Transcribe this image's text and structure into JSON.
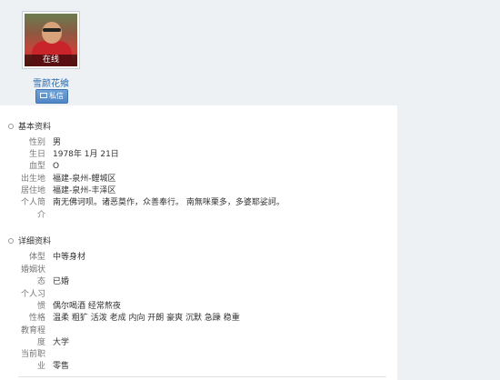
{
  "profile": {
    "status": "在线",
    "username": "雪颜花飨",
    "message_button": "私信"
  },
  "basic": {
    "title": "基本资料",
    "rows": [
      {
        "label": "性别",
        "value": "男"
      },
      {
        "label": "生日",
        "value": "1978年 1月 21日"
      },
      {
        "label": "血型",
        "value": "O"
      },
      {
        "label": "出生地",
        "value": "福建-泉州-鲤城区"
      },
      {
        "label": "居住地",
        "value": "福建-泉州-丰泽区"
      },
      {
        "label_line1": "个人简",
        "label_line2": "介",
        "value": "南无佛诃呗。诸恶莫作，众善奉行。 南無咪栗多，多婆耶娑訶。"
      }
    ]
  },
  "detail": {
    "title": "详细资料",
    "rows": [
      {
        "label": "体型",
        "value": "中等身材"
      },
      {
        "label_line1": "婚姻状",
        "label_line2": "态",
        "value": "已婚"
      },
      {
        "label_line1": "个人习",
        "label_line2": "惯",
        "value": "偶尔喝酒 经常熬夜"
      },
      {
        "label": "性格",
        "value": "温柔 粗犷 活泼 老成 内向 开朗 豪爽 沉默 急躁 稳重"
      },
      {
        "label_line1": "教育程",
        "label_line2": "度",
        "value": "大学"
      },
      {
        "label_line1": "当前职",
        "label_line2": "业",
        "value": "零售"
      }
    ]
  }
}
